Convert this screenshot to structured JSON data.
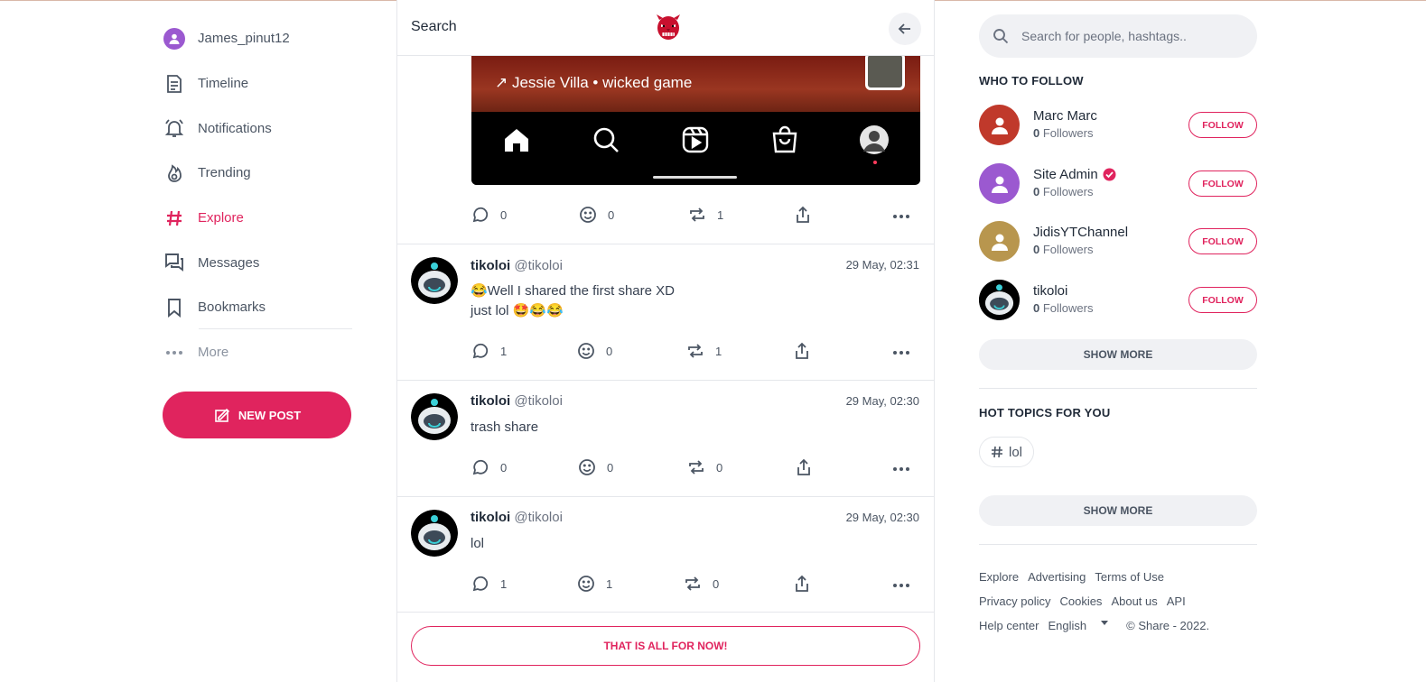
{
  "sidebar": {
    "user": {
      "label": "James_pinut12",
      "icon": "user-avatar-icon",
      "color": "#9b59d0"
    },
    "items": [
      {
        "label": "Timeline",
        "icon": "document-icon"
      },
      {
        "label": "Notifications",
        "icon": "bell-icon"
      },
      {
        "label": "Trending",
        "icon": "flame-icon"
      },
      {
        "label": "Explore",
        "icon": "hashtag-icon",
        "active": true
      },
      {
        "label": "Messages",
        "icon": "chat-icon"
      },
      {
        "label": "Bookmarks",
        "icon": "bookmark-icon"
      },
      {
        "label": "More",
        "icon": "dots-icon"
      }
    ],
    "new_post": "NEW POST"
  },
  "header": {
    "title": "Search",
    "logo": "demon-mask-logo",
    "back_icon": "arrow-left-icon"
  },
  "media": {
    "caption": "↗ Jessie Villa • wicked game"
  },
  "top_actions": {
    "comments": "0",
    "reactions": "0",
    "reposts": "1"
  },
  "posts": [
    {
      "name": "tikoloi",
      "handle": "@tikoloi",
      "date": "29 May, 02:31",
      "line1": "😂Well I shared the first share XD",
      "line2": "just lol 🤩😂😂",
      "comments": "1",
      "reactions": "0",
      "reposts": "1"
    },
    {
      "name": "tikoloi",
      "handle": "@tikoloi",
      "date": "29 May, 02:30",
      "line1": "trash share",
      "line2": "",
      "comments": "0",
      "reactions": "0",
      "reposts": "0"
    },
    {
      "name": "tikoloi",
      "handle": "@tikoloi",
      "date": "29 May, 02:30",
      "line1": "lol",
      "line2": "",
      "comments": "1",
      "reactions": "1",
      "reposts": "0"
    }
  ],
  "all_for_now": "THAT IS ALL FOR NOW!",
  "search": {
    "placeholder": "Search for people, hashtags.."
  },
  "who_to_follow": {
    "title": "WHO TO FOLLOW",
    "users": [
      {
        "name": "Marc Marc",
        "count": "0",
        "followers": "Followers",
        "color": "#c0392b",
        "verified": false
      },
      {
        "name": "Site Admin",
        "count": "0",
        "followers": "Followers",
        "color": "#9b59d0",
        "verified": true
      },
      {
        "name": "JidisYTChannel",
        "count": "0",
        "followers": "Followers",
        "color": "#b8964e",
        "verified": false
      },
      {
        "name": "tikoloi",
        "count": "0",
        "followers": "Followers",
        "color": "#000000",
        "verified": false
      }
    ],
    "follow_label": "FOLLOW",
    "show_more": "SHOW MORE"
  },
  "hot_topics": {
    "title": "HOT TOPICS FOR YOU",
    "tags": [
      "lol"
    ],
    "show_more": "SHOW MORE"
  },
  "footer": {
    "links_row1": [
      "Explore",
      "Advertising",
      "Terms of Use"
    ],
    "links_row2": [
      "Privacy policy",
      "Cookies",
      "About us",
      "API"
    ],
    "help": "Help center",
    "language": "English",
    "copyright": "© Share - 2022."
  },
  "colors": {
    "accent": "#e0245e"
  }
}
